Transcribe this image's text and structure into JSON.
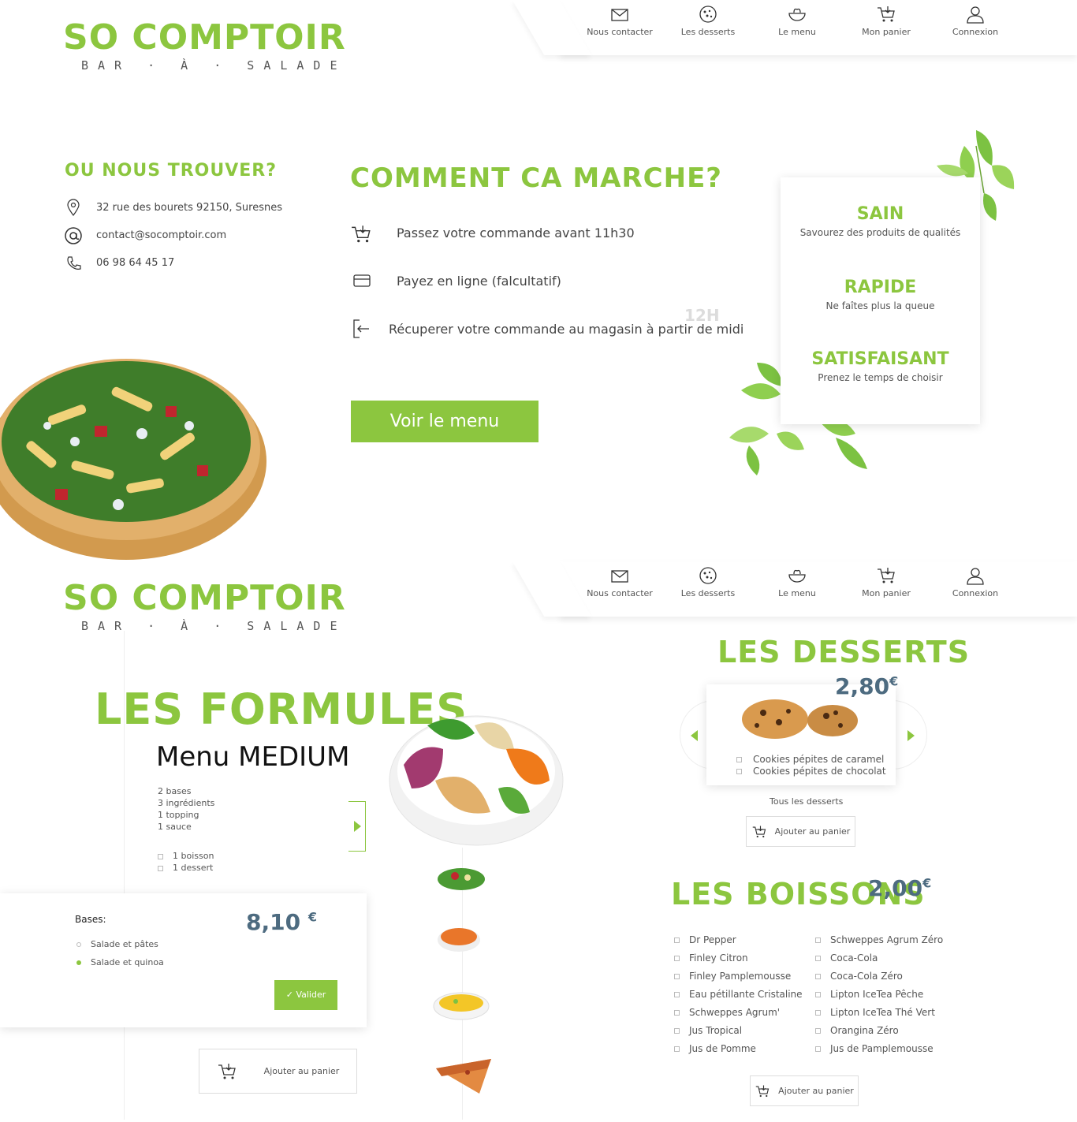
{
  "brand": {
    "name": "SO COMPTOIR",
    "tagline": "BAR · À · SALADE"
  },
  "nav": [
    {
      "label": "Nous contacter",
      "icon": "envelope-icon"
    },
    {
      "label": "Les desserts",
      "icon": "cookie-icon"
    },
    {
      "label": "Le menu",
      "icon": "salad-bowl-icon"
    },
    {
      "label": "Mon panier",
      "icon": "cart-icon"
    },
    {
      "label": "Connexion",
      "icon": "user-icon"
    }
  ],
  "find_us": {
    "title": "OU NOUS TROUVER?",
    "address": "32 rue des bourets 92150, Suresnes",
    "email": "contact@socomptoir.com",
    "phone": "06 98 64 45 17"
  },
  "how": {
    "title": "COMMENT CA MARCHE?",
    "steps": [
      "Passez votre commande  avant  11h30",
      "Payez en ligne (falcultatif)",
      "Récuperer votre commande au magasin à partir de midi"
    ],
    "badge": "12H",
    "cta": "Voir le menu"
  },
  "features": [
    {
      "title": "SAIN",
      "text": "Savourez des produits de qualités"
    },
    {
      "title": "RAPIDE",
      "text": "Ne faîtes plus la queue"
    },
    {
      "title": "SATISFAISANT",
      "text": "Prenez le temps de choisir"
    }
  ],
  "formules": {
    "title": "LES FORMULES",
    "menu_name": "Menu MEDIUM",
    "contents": [
      "2 bases",
      "3 ingrédients",
      "1 topping",
      "1 sauce"
    ],
    "extras": [
      "1 boisson",
      "1 dessert"
    ],
    "bases_label": "Bases:",
    "bases": [
      "Salade et pâtes",
      "Salade et quinoa"
    ],
    "price": "8,10",
    "currency": "€",
    "validate": "Valider",
    "add_to_cart": "Ajouter au panier"
  },
  "desserts": {
    "title": "LES DESSERTS",
    "price": "2,80",
    "currency": "€",
    "items": [
      "Cookies pépites de caramel",
      "Cookies pépites de chocolat"
    ],
    "all_link": "Tous les desserts",
    "add_to_cart": "Ajouter au panier"
  },
  "boissons": {
    "title": "LES BOISSONS",
    "price": "2,00",
    "currency": "€",
    "left": [
      "Dr Pepper",
      "Finley Citron",
      "Finley Pamplemousse",
      "Eau pétillante Cristaline",
      "Schweppes Agrum'",
      "Jus Tropical",
      "Jus de Pomme"
    ],
    "right": [
      "Schweppes Agrum Zéro",
      "Coca-Cola",
      "Coca-Cola Zéro",
      "Lipton IceTea Pêche",
      "Lipton IceTea Thé Vert",
      "Orangina Zéro",
      "Jus de Pamplemousse"
    ],
    "add_to_cart": "Ajouter au panier"
  },
  "colors": {
    "accent": "#8cc63f",
    "price": "#4d6b80"
  }
}
